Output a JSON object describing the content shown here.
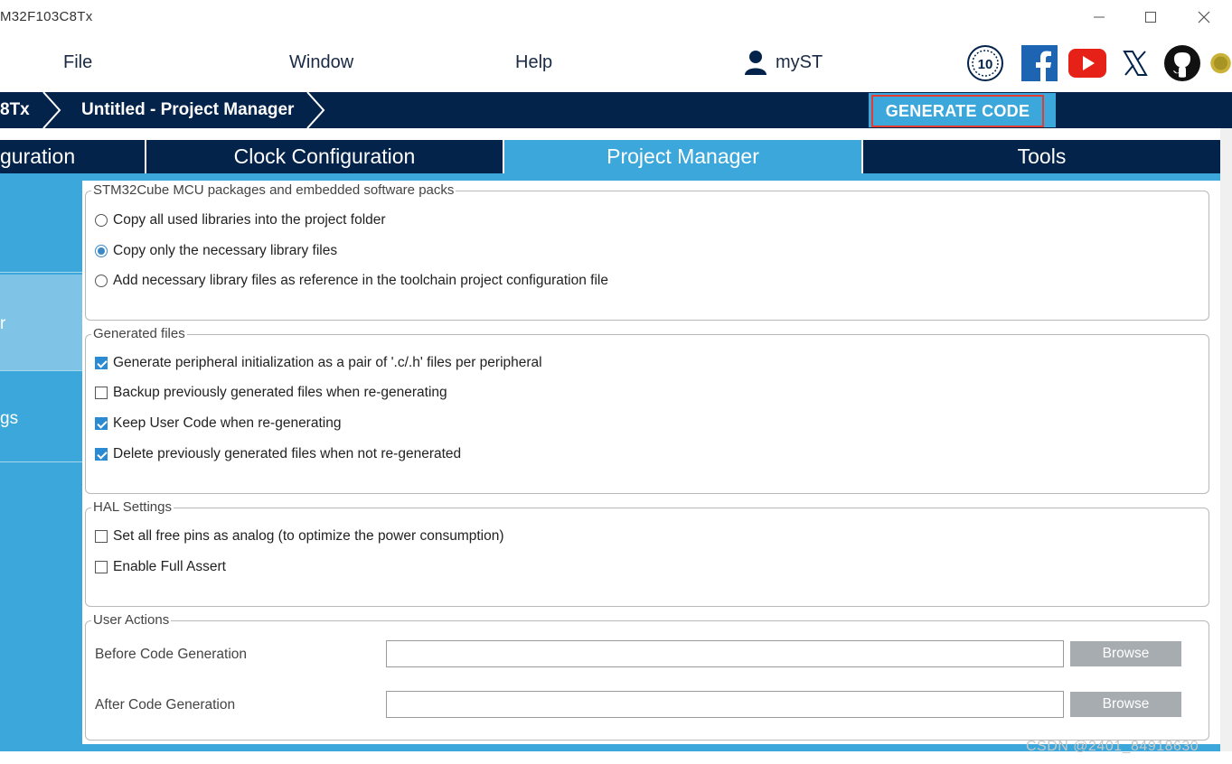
{
  "window": {
    "title": "M32F103C8Tx",
    "minimize_icon": "minimize-icon",
    "maximize_icon": "maximize-icon",
    "close_icon": "close-icon"
  },
  "menu": {
    "file": "File",
    "window": "Window",
    "help": "Help",
    "myst": "myST"
  },
  "social_icons": [
    "st-10-years-icon",
    "facebook-icon",
    "youtube-icon",
    "x-icon",
    "github-icon",
    "st-star-icon"
  ],
  "breadcrumb": {
    "chip": "8Tx",
    "project": "Untitled - Project Manager"
  },
  "generate_button": "GENERATE CODE",
  "tabs": [
    {
      "label": "guration",
      "active": false
    },
    {
      "label": "Clock Configuration",
      "active": false
    },
    {
      "label": "Project Manager",
      "active": true
    },
    {
      "label": "Tools",
      "active": false
    }
  ],
  "sidebar": {
    "items": [
      "",
      "r",
      "gs"
    ]
  },
  "packages": {
    "legend": "STM32Cube MCU packages and embedded software packs",
    "options": [
      {
        "label": "Copy all used libraries into the project folder",
        "selected": false
      },
      {
        "label": "Copy only the necessary library files",
        "selected": true
      },
      {
        "label": "Add necessary library files as reference in the toolchain project configuration file",
        "selected": false
      }
    ]
  },
  "generated_files": {
    "legend": "Generated files",
    "options": [
      {
        "label": "Generate peripheral initialization as a pair of '.c/.h' files per peripheral",
        "checked": true
      },
      {
        "label": "Backup previously generated files when re-generating",
        "checked": false
      },
      {
        "label": "Keep User Code when re-generating",
        "checked": true
      },
      {
        "label": "Delete previously generated files when not re-generated",
        "checked": true
      }
    ]
  },
  "hal_settings": {
    "legend": "HAL Settings",
    "options": [
      {
        "label": "Set all free pins as analog (to optimize the power consumption)",
        "checked": false
      },
      {
        "label": "Enable Full Assert",
        "checked": false
      }
    ]
  },
  "user_actions": {
    "legend": "User Actions",
    "before_label": "Before Code Generation",
    "before_value": "",
    "after_label": "After Code Generation",
    "after_value": "",
    "browse": "Browse"
  },
  "watermark": "CSDN @2401_84918630",
  "colors": {
    "navy": "#03234b",
    "accent": "#3ca7da",
    "highlight": "#e03c31"
  }
}
